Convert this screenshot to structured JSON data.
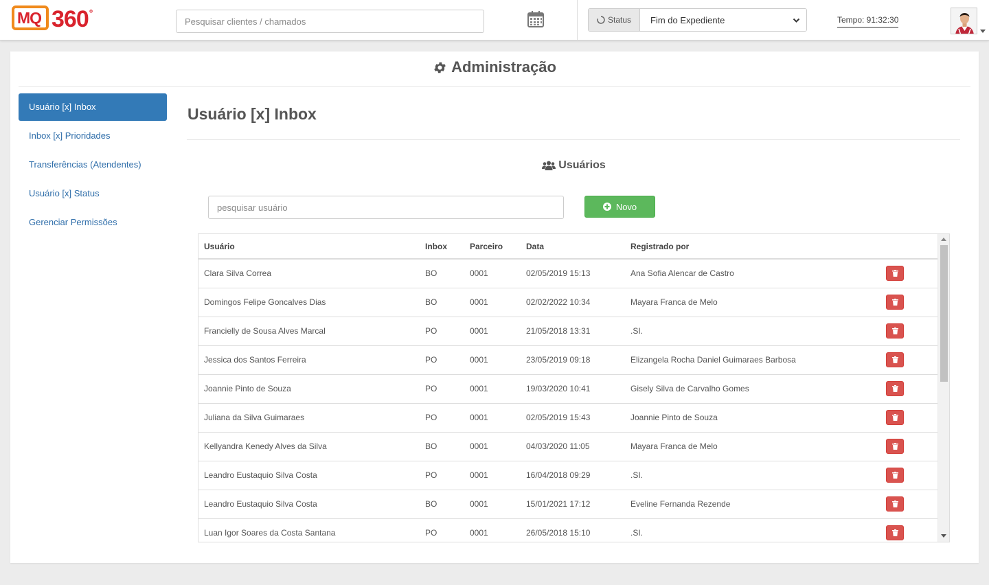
{
  "header": {
    "logo": {
      "mq": "MQ",
      "num": "360",
      "deg": "°"
    },
    "search_placeholder": "Pesquisar clientes / chamados",
    "status_label": "Status",
    "status_value": "Fim do Expediente",
    "timer": "Tempo: 91:32:30"
  },
  "page": {
    "title": "Administração",
    "sidebar": [
      {
        "label": "Usuário [x] Inbox",
        "active": true
      },
      {
        "label": "Inbox [x] Prioridades",
        "active": false
      },
      {
        "label": "Transferências (Atendentes)",
        "active": false
      },
      {
        "label": "Usuário [x] Status",
        "active": false
      },
      {
        "label": "Gerenciar Permissões",
        "active": false
      }
    ],
    "section_title": "Usuário [x] Inbox",
    "subsection_title": "Usuários",
    "user_search_placeholder": "pesquisar usuário",
    "new_button": "Novo"
  },
  "table": {
    "columns": [
      "Usuário",
      "Inbox",
      "Parceiro",
      "Data",
      "Registrado por"
    ],
    "rows": [
      {
        "usuario": "Clara Silva Correa",
        "inbox": "BO",
        "parceiro": "0001",
        "data": "02/05/2019 15:13",
        "registrado": "Ana Sofia Alencar de Castro"
      },
      {
        "usuario": "Domingos Felipe Goncalves Dias",
        "inbox": "BO",
        "parceiro": "0001",
        "data": "02/02/2022 10:34",
        "registrado": "Mayara Franca de Melo"
      },
      {
        "usuario": "Francielly de Sousa Alves Marcal",
        "inbox": "PO",
        "parceiro": "0001",
        "data": "21/05/2018 13:31",
        "registrado": ".SI."
      },
      {
        "usuario": "Jessica dos Santos Ferreira",
        "inbox": "PO",
        "parceiro": "0001",
        "data": "23/05/2019 09:18",
        "registrado": "Elizangela Rocha Daniel Guimaraes Barbosa"
      },
      {
        "usuario": "Joannie Pinto de Souza",
        "inbox": "PO",
        "parceiro": "0001",
        "data": "19/03/2020 10:41",
        "registrado": "Gisely Silva de Carvalho Gomes"
      },
      {
        "usuario": "Juliana da Silva Guimaraes",
        "inbox": "PO",
        "parceiro": "0001",
        "data": "02/05/2019 15:43",
        "registrado": "Joannie Pinto de Souza"
      },
      {
        "usuario": "Kellyandra Kenedy Alves da Silva",
        "inbox": "BO",
        "parceiro": "0001",
        "data": "04/03/2020 11:05",
        "registrado": "Mayara Franca de Melo"
      },
      {
        "usuario": "Leandro Eustaquio Silva Costa",
        "inbox": "PO",
        "parceiro": "0001",
        "data": "16/04/2018 09:29",
        "registrado": ".SI."
      },
      {
        "usuario": "Leandro Eustaquio Silva Costa",
        "inbox": "BO",
        "parceiro": "0001",
        "data": "15/01/2021 17:12",
        "registrado": "Eveline Fernanda Rezende"
      },
      {
        "usuario": "Luan Igor Soares da Costa Santana",
        "inbox": "PO",
        "parceiro": "0001",
        "data": "26/05/2018 15:10",
        "registrado": ".SI."
      }
    ]
  },
  "icons": {
    "calendar": "calendar-icon",
    "status": "spinner-icon",
    "settings": "gear-icon",
    "users": "users-icon",
    "add": "plus-circle-icon",
    "delete": "trash-icon"
  },
  "colors": {
    "primary": "#337ab7",
    "success": "#5cb85c",
    "danger": "#d9534f",
    "logo_red": "#d9232d",
    "logo_orange": "#f08a1c"
  }
}
